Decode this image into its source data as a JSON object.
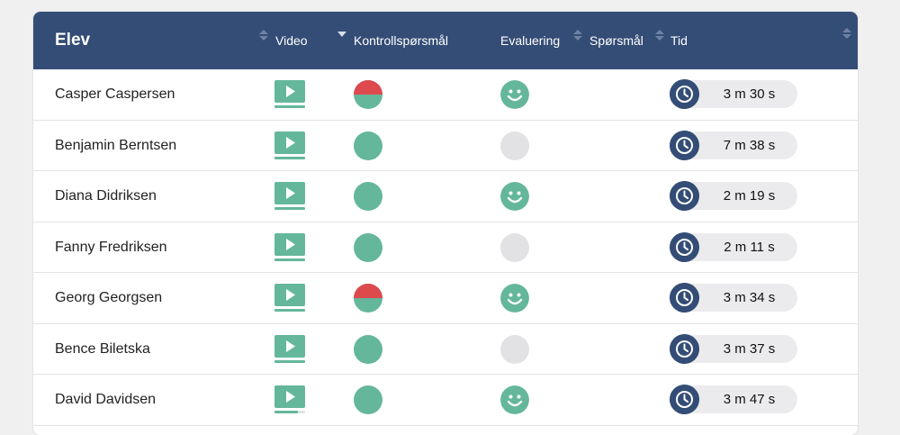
{
  "header": {
    "elev": "Elev",
    "video": "Video",
    "kontroll": "Kontrollspørsmål",
    "evaluering": "Evaluering",
    "sporsmal": "Spørsmål",
    "tid": "Tid"
  },
  "colors": {
    "header_bg": "#344d76",
    "green": "#64b79b",
    "red": "#dd4a4e",
    "grey": "#e2e2e5"
  },
  "rows": [
    {
      "name": "Casper Caspersen",
      "video": "watched",
      "kontroll": "half-wrong",
      "evaluering": "smiley",
      "tid": "3 m 30 s"
    },
    {
      "name": "Benjamin Berntsen",
      "video": "watched",
      "kontroll": "correct",
      "evaluering": "none",
      "tid": "7 m 38 s"
    },
    {
      "name": "Diana Didriksen",
      "video": "watched",
      "kontroll": "correct",
      "evaluering": "smiley",
      "tid": "2 m 19 s"
    },
    {
      "name": "Fanny Fredriksen",
      "video": "watched",
      "kontroll": "correct",
      "evaluering": "none",
      "tid": "2 m 11 s"
    },
    {
      "name": "Georg Georgsen",
      "video": "watched",
      "kontroll": "half-wrong",
      "evaluering": "smiley",
      "tid": "3 m 34 s"
    },
    {
      "name": "Bence Biletska",
      "video": "watched",
      "kontroll": "correct",
      "evaluering": "none",
      "tid": "3 m 37 s"
    },
    {
      "name": "David Davidsen",
      "video": "partial",
      "kontroll": "correct",
      "evaluering": "smiley",
      "tid": "3 m 47 s"
    }
  ]
}
